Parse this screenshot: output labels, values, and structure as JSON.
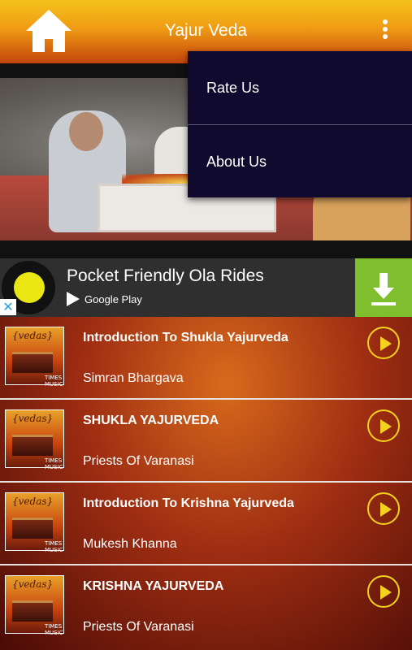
{
  "appbar": {
    "title": "Yajur Veda",
    "home_icon": "home-icon",
    "overflow_icon": "more-vertical-icon"
  },
  "menu": {
    "items": [
      {
        "label": "Rate Us"
      },
      {
        "label": "About Us"
      }
    ]
  },
  "ad": {
    "title": "Pocket Friendly Ola Rides",
    "store": "Google Play",
    "close_glyph": "✕",
    "cta_icon": "download-icon"
  },
  "thumb": {
    "title": "{vedas}",
    "badge": "TIMES MUSIC"
  },
  "tracks": [
    {
      "title": "Introduction To Shukla Yajurveda",
      "artist": "Simran Bhargava"
    },
    {
      "title": "SHUKLA YAJURVEDA",
      "artist": "Priests Of Varanasi"
    },
    {
      "title": "Introduction To Krishna Yajurveda",
      "artist": "Mukesh Khanna"
    },
    {
      "title": "KRISHNA YAJURVEDA",
      "artist": "Priests Of Varanasi"
    }
  ],
  "colors": {
    "menu_bg": "#100b2e",
    "accent_yellow": "#f5d21e",
    "ad_cta": "#7fbe2c"
  }
}
